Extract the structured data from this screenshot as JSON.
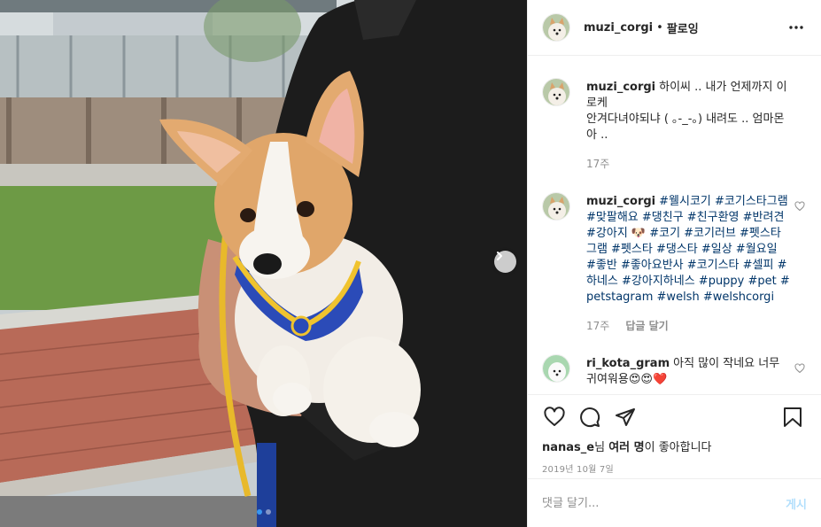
{
  "post": {
    "username": "muzi_corgi",
    "separator": "•",
    "follow_label": "팔로잉",
    "more_icon": "more-horizontal-icon"
  },
  "comments": [
    {
      "username": "muzi_corgi",
      "text": "하이씨 .. 내가 언제까지 이로케\n안겨다녀야되냐 ( ｡-_-｡) 내려도 .. 엄마몬아 ..",
      "time": "17주",
      "reply_label": ""
    },
    {
      "username": "muzi_corgi",
      "text": "#웰시코기 #코기스타그램 #맞팔해요 #댕친구 #친구환영 #반려견 #강아지 🐶 #코기 #코기러브 #펫스타그램 #펫스타 #댕스타 #일상 #월요일 #좋반 #좋아요반사 #코기스타 #셀피 #하네스 #강아지하네스 #puppy #pet #petstagram #welsh #welshcorgi",
      "time": "17주",
      "reply_label": "답글 달기"
    },
    {
      "username": "ri_kota_gram",
      "text": "아직 많이 작네요 너무 귀여워용😍😍❤️",
      "time": "",
      "reply_label": ""
    }
  ],
  "likes": {
    "user": "nanas_e",
    "middle": "님 ",
    "others": "여러 명",
    "suffix": "이 좋아합니다"
  },
  "date": "2019년 10월 7일",
  "comment_input": {
    "placeholder": "댓글 달기...",
    "value": ""
  },
  "post_button": "게시",
  "carousel": {
    "next_icon": "chevron-right-icon",
    "slide_count": 2,
    "active_index": 0
  },
  "colors": {
    "link": "#003569",
    "active_dot": "#3897f0",
    "post_button_disabled": "#b2dffc",
    "meta_text": "#8e8e8e"
  }
}
